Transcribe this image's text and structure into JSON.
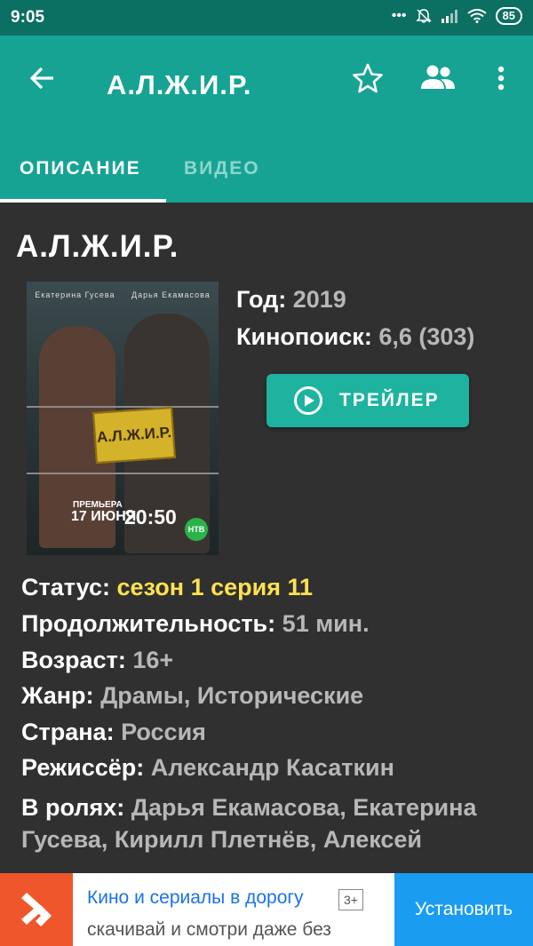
{
  "status_bar": {
    "time": "9:05",
    "battery": "85"
  },
  "app_bar": {
    "title": "А.Л.Ж.И.Р.",
    "tabs": [
      {
        "label": "ОПИСАНИЕ",
        "active": true
      },
      {
        "label": "ВИДЕО",
        "active": false
      }
    ]
  },
  "show": {
    "title": "А.Л.Ж.И.Р.",
    "poster": {
      "actor1": "Екатерина Гусева",
      "actor2": "Дарья Екамасова",
      "sign": "А.Л.Ж.И.Р.",
      "premiere": "ПРЕМЬЕРА",
      "date": "17 ИЮНЯ",
      "time": "20:50",
      "channel": "НТВ"
    },
    "year_label": "Год",
    "year": "2019",
    "rating_label": "Кинопоиск",
    "rating": "6,6 (303)",
    "trailer_label": "ТРЕЙЛЕР",
    "status_label": "Статус",
    "status": "сезон 1 серия 11",
    "duration_label": "Продолжительность",
    "duration": "51 мин.",
    "age_label": "Возраст",
    "age": "16+",
    "genre_label": "Жанр",
    "genre": "Драмы, Исторические",
    "country_label": "Страна",
    "country": "Россия",
    "director_label": "Режиссёр",
    "director": "Александр Касаткин",
    "cast_label": "В ролях",
    "cast": "Дарья Екамасова, Екатерина Гусева, Кирилл Плетнёв, Алексей"
  },
  "ad": {
    "title": "Кино и сериалы в дорогу",
    "age_badge": "3+",
    "subtitle": "скачивай и смотри даже без",
    "install": "Установить"
  },
  "colors": {
    "status_bar": "#0b6f62",
    "app_bar": "#16a394",
    "background": "#303030",
    "accent": "#1db39f",
    "status_value": "#fde24f"
  }
}
